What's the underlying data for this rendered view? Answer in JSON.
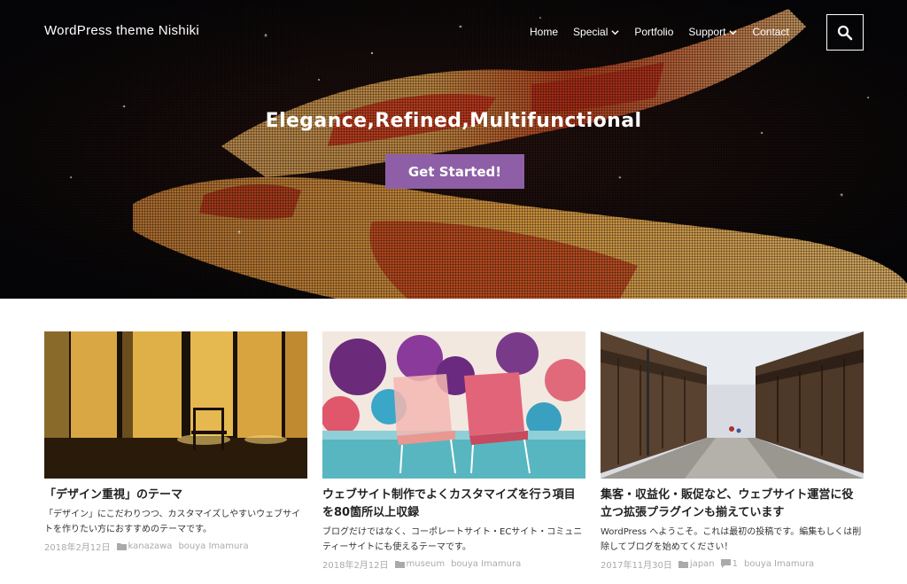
{
  "header": {
    "site_title": "WordPress theme Nishiki",
    "nav": [
      {
        "label": "Home",
        "has_submenu": false
      },
      {
        "label": "Special",
        "has_submenu": true
      },
      {
        "label": "Portfolio",
        "has_submenu": false
      },
      {
        "label": "Support",
        "has_submenu": true
      },
      {
        "label": "Contact",
        "has_submenu": false
      }
    ],
    "search_icon": "search-icon"
  },
  "hero": {
    "heading": "Elegance,Refined,Multifunctional",
    "button_label": "Get Started!",
    "button_color": "#8e5fa6"
  },
  "posts": [
    {
      "title": "「デザイン重視」のテーマ",
      "excerpt": "「デザイン」にこだわりつつ、カスタマイズしやすいウェブサイトを作りたい方におすすめのテーマです。",
      "date": "2018年2月12日",
      "category": "kanazawa",
      "author": "bouya Imamura",
      "comments": null
    },
    {
      "title": "ウェブサイト制作でよくカスタマイズを行う項目を80箇所以上収録",
      "excerpt": "ブログだけではなく、コーポレートサイト・ECサイト・コミュニティーサイトにも使えるテーマです。",
      "date": "2018年2月12日",
      "category": "museum",
      "author": "bouya Imamura",
      "comments": null
    },
    {
      "title": "集客・収益化・販促など、ウェブサイト運営に役立つ拡張プラグインも揃えています",
      "excerpt": "WordPress へようこそ。これは最初の投稿です。編集もしくは削除してブログを始めてください！",
      "date": "2017年11月30日",
      "category": "japan",
      "author": "bouya Imamura",
      "comments": "1"
    }
  ]
}
